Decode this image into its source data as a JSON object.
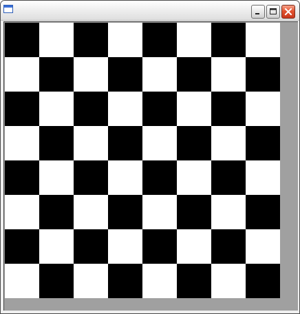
{
  "window": {
    "title": ""
  },
  "titlebar": {
    "app_icon": "window-icon",
    "buttons": [
      {
        "name": "minimize",
        "icon": "minimize-icon"
      },
      {
        "name": "maximize",
        "icon": "maximize-icon"
      },
      {
        "name": "close",
        "icon": "close-icon"
      }
    ]
  },
  "board": {
    "rows": 8,
    "cols": 8,
    "top_left_color": "dark",
    "cells": [
      [
        "dark",
        "light",
        "dark",
        "light",
        "dark",
        "light",
        "dark",
        "light"
      ],
      [
        "light",
        "dark",
        "light",
        "dark",
        "light",
        "dark",
        "light",
        "dark"
      ],
      [
        "dark",
        "light",
        "dark",
        "light",
        "dark",
        "light",
        "dark",
        "light"
      ],
      [
        "light",
        "dark",
        "light",
        "dark",
        "light",
        "dark",
        "light",
        "dark"
      ],
      [
        "dark",
        "light",
        "dark",
        "light",
        "dark",
        "light",
        "dark",
        "light"
      ],
      [
        "light",
        "dark",
        "light",
        "dark",
        "light",
        "dark",
        "light",
        "dark"
      ],
      [
        "dark",
        "light",
        "dark",
        "light",
        "dark",
        "light",
        "dark",
        "light"
      ],
      [
        "light",
        "dark",
        "light",
        "dark",
        "light",
        "dark",
        "light",
        "dark"
      ]
    ]
  },
  "colors": {
    "dark": "#000000",
    "light": "#ffffff",
    "background": "#a0a0a0",
    "close_button": "#d9452a"
  }
}
